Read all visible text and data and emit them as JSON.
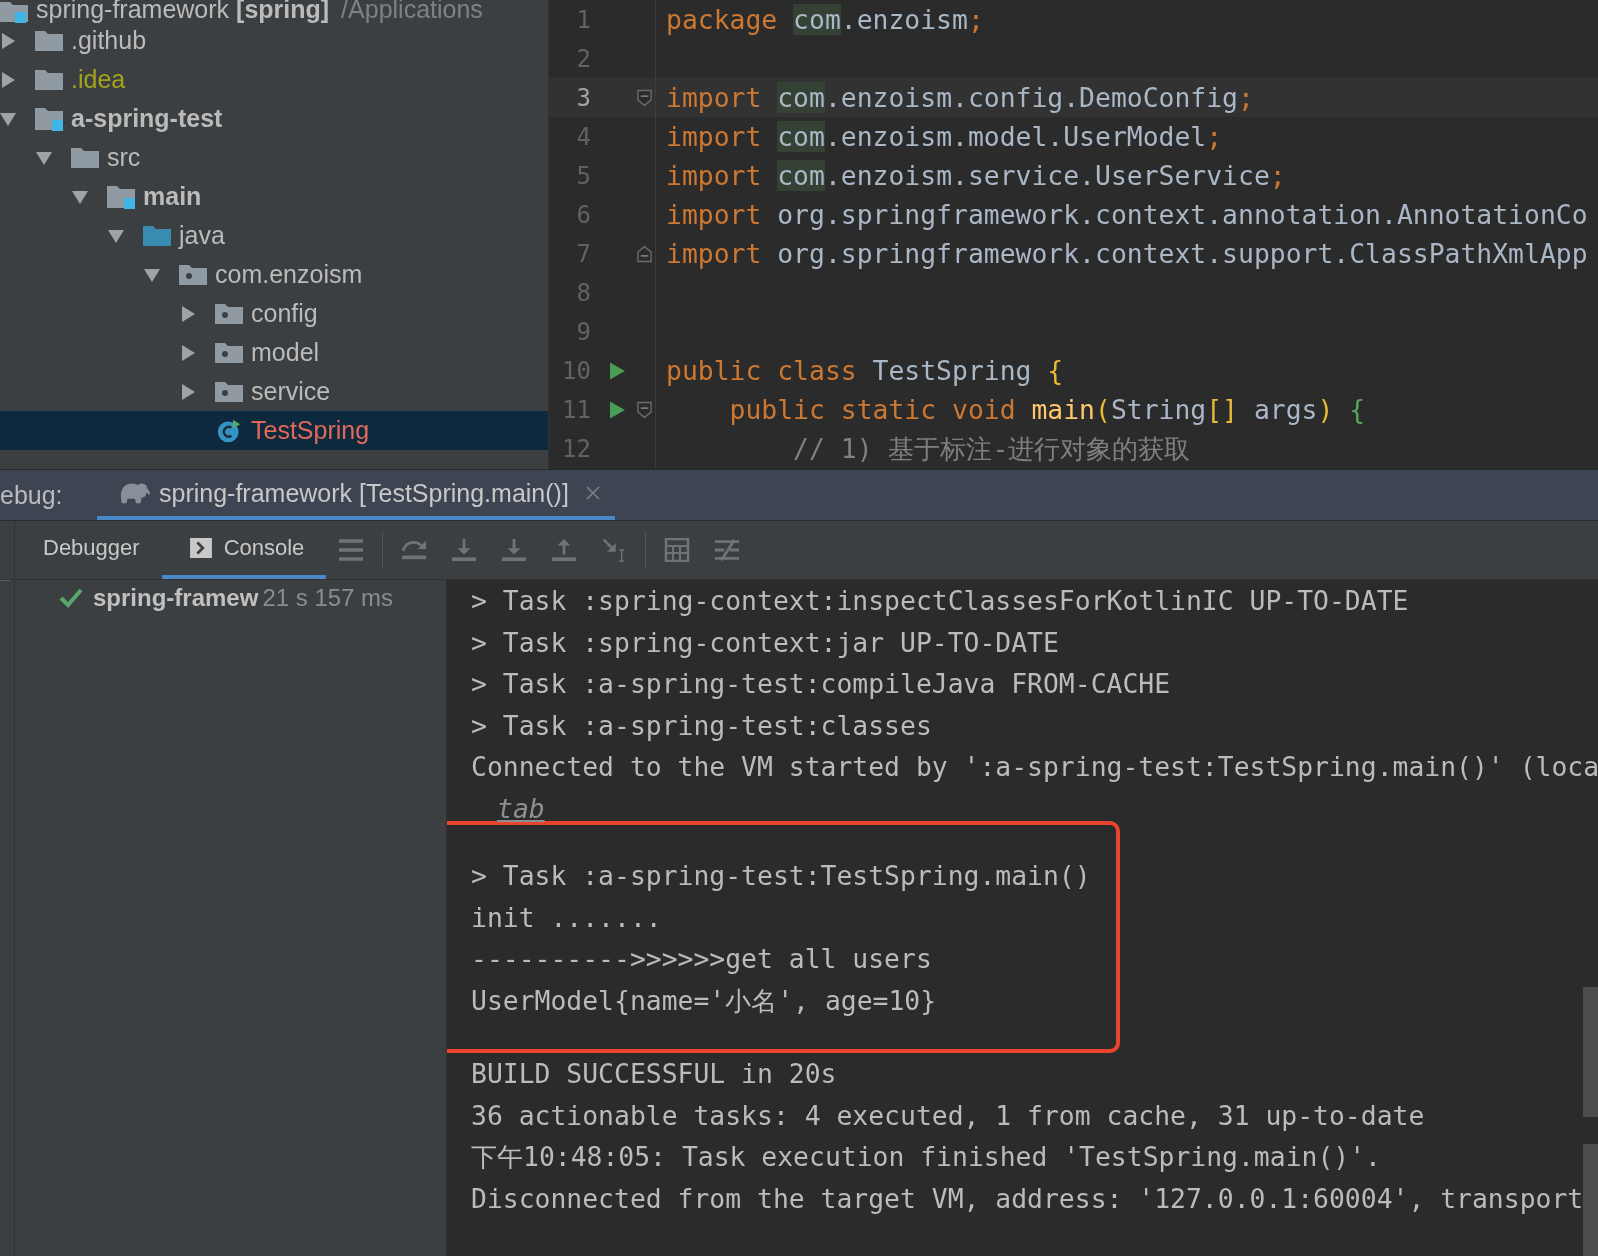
{
  "project_tree": {
    "root": {
      "label": "spring-framework **[spring]**",
      "path": "/Applications",
      "children": [
        {
          "label": ".github",
          "kind": "folder",
          "color": "#bbbbbb",
          "expanded": false,
          "selected": false
        },
        {
          "label": ".idea",
          "kind": "folder",
          "color": "#a2a21c",
          "expanded": false,
          "selected": false
        },
        {
          "label": "a-spring-test",
          "kind": "module",
          "color": "#bbbbbb",
          "expanded": true,
          "selected": false,
          "children": [
            {
              "label": "src",
              "kind": "folder",
              "color": "#bbbbbb",
              "expanded": true,
              "selected": false,
              "children": [
                {
                  "label": "main",
                  "kind": "module",
                  "color": "#bbbbbb",
                  "expanded": true,
                  "selected": false,
                  "children": [
                    {
                      "label": "java",
                      "kind": "source",
                      "color": "#bbbbbb",
                      "expanded": true,
                      "selected": false,
                      "children": [
                        {
                          "label": "com.enzoism",
                          "kind": "package",
                          "color": "#bbbbbb",
                          "expanded": true,
                          "selected": false,
                          "children": [
                            {
                              "label": "config",
                              "kind": "package",
                              "color": "#bbbbbb",
                              "expanded": false,
                              "selected": false
                            },
                            {
                              "label": "model",
                              "kind": "package",
                              "color": "#bbbbbb",
                              "expanded": false,
                              "selected": false
                            },
                            {
                              "label": "service",
                              "kind": "package",
                              "color": "#bbbbbb",
                              "expanded": false,
                              "selected": false
                            },
                            {
                              "label": "TestSpring",
                              "kind": "class",
                              "color": "#e0695a",
                              "selected": true
                            }
                          ]
                        }
                      ]
                    }
                  ]
                }
              ]
            }
          ]
        }
      ]
    }
  },
  "editor": {
    "lines": [
      {
        "number": "1",
        "current": false,
        "run": false,
        "fold_start": false,
        "fold_end": false,
        "tokens": [
          {
            "kind": "keyword",
            "text": "package "
          },
          {
            "kind": "highlight",
            "text": "com"
          },
          {
            "kind": "plain",
            "text": ".enzoism"
          },
          {
            "kind": "keyword",
            "text": ";"
          }
        ]
      },
      {
        "number": "2",
        "current": false,
        "run": false,
        "fold_start": false,
        "fold_end": false
      },
      {
        "number": "3",
        "current": true,
        "run": false,
        "fold_start": true,
        "fold_end": false,
        "tokens": [
          {
            "kind": "keyword",
            "text": "import "
          },
          {
            "kind": "highlight",
            "text": "com"
          },
          {
            "kind": "plain",
            "text": ".enzoism.config.DemoConfig"
          },
          {
            "kind": "keyword",
            "text": ";"
          }
        ]
      },
      {
        "number": "4",
        "current": false,
        "run": false,
        "fold_start": false,
        "fold_end": false,
        "tokens": [
          {
            "kind": "keyword",
            "text": "import "
          },
          {
            "kind": "highlight",
            "text": "com"
          },
          {
            "kind": "plain",
            "text": ".enzoism.model.UserModel"
          },
          {
            "kind": "keyword",
            "text": ";"
          }
        ]
      },
      {
        "number": "5",
        "current": false,
        "run": false,
        "fold_start": false,
        "fold_end": false,
        "tokens": [
          {
            "kind": "keyword",
            "text": "import "
          },
          {
            "kind": "highlight",
            "text": "com"
          },
          {
            "kind": "plain",
            "text": ".enzoism.service.UserService"
          },
          {
            "kind": "keyword",
            "text": ";"
          }
        ]
      },
      {
        "number": "6",
        "current": false,
        "run": false,
        "fold_start": false,
        "fold_end": false,
        "tokens": [
          {
            "kind": "keyword",
            "text": "import"
          },
          {
            "kind": "plain",
            "text": " org.springframework.context.annotation.AnnotationCo"
          }
        ]
      },
      {
        "number": "7",
        "current": false,
        "run": false,
        "fold_start": false,
        "fold_end": true,
        "tokens": [
          {
            "kind": "keyword",
            "text": "import"
          },
          {
            "kind": "plain",
            "text": " org.springframework.context.support.ClassPathXmlApp"
          }
        ]
      },
      {
        "number": "8",
        "current": false,
        "run": false,
        "fold_start": false,
        "fold_end": false
      },
      {
        "number": "9",
        "current": false,
        "run": false,
        "fold_start": false,
        "fold_end": false
      },
      {
        "number": "10",
        "current": false,
        "run": true,
        "fold_start": false,
        "fold_end": false,
        "tokens": [
          {
            "kind": "keyword",
            "text": "public class"
          },
          {
            "kind": "plain",
            "text": " TestSpring "
          },
          {
            "kind": "brace1",
            "text": "{"
          }
        ]
      },
      {
        "number": "11",
        "current": false,
        "run": true,
        "fold_start": true,
        "fold_end": false,
        "tokens": [
          {
            "kind": "keyword",
            "text": "    public static void "
          },
          {
            "kind": "method",
            "text": "main"
          },
          {
            "kind": "brace1",
            "text": "("
          },
          {
            "kind": "plain",
            "text": "String"
          },
          {
            "kind": "brace1",
            "text": "[]"
          },
          {
            "kind": "plain",
            "text": " args"
          },
          {
            "kind": "brace1",
            "text": ")"
          },
          {
            "kind": "brace2",
            "text": " {"
          }
        ]
      },
      {
        "number": "12",
        "current": false,
        "run": false,
        "fold_start": false,
        "fold_end": false,
        "tokens": [
          {
            "kind": "comment",
            "text": "        // 1) 基于标注-进行对象的获取"
          }
        ]
      }
    ]
  },
  "debug_bar": {
    "label": "ebug:",
    "tabs": [
      {
        "label": "spring-framework [TestSpring.main()]",
        "selected": true
      }
    ]
  },
  "tool_tabs": [
    {
      "label": "Debugger",
      "kind": "debugger",
      "selected": false
    },
    {
      "label": "Console",
      "kind": "console",
      "selected": true
    }
  ],
  "runs": [
    {
      "name": "spring-framew",
      "time": "21 s 157 ms",
      "passed": true
    }
  ],
  "console": {
    "segments": [
      {
        "boxed": false,
        "lines": [
          {
            "kind": "text",
            "text": "> Task :spring-context:inspectClassesForKotlinIC UP-TO-DATE"
          },
          {
            "kind": "text",
            "text": "> Task :spring-context:jar UP-TO-DATE"
          },
          {
            "kind": "text",
            "text": "> Task :a-spring-test:compileJava FROM-CACHE"
          },
          {
            "kind": "text",
            "text": "> Task :a-spring-test:classes"
          },
          {
            "kind": "text",
            "text": "Connected to the VM started by ':a-spring-test:TestSpring.main()' (loca"
          },
          {
            "kind": "link",
            "text": "tab"
          }
        ]
      },
      {
        "boxed": true,
        "lines": [
          {
            "kind": "text",
            "text": "> Task :a-spring-test:TestSpring.main()"
          },
          {
            "kind": "text",
            "text": "init ......."
          },
          {
            "kind": "text",
            "text": "---------->>>>>>get all users"
          },
          {
            "kind": "text",
            "text": "UserModel{name='小名', age=10}"
          }
        ]
      },
      {
        "boxed": false,
        "lines": [
          {
            "kind": "text",
            "text": "BUILD SUCCESSFUL in 20s"
          },
          {
            "kind": "text",
            "text": "36 actionable tasks: 4 executed, 1 from cache, 31 up-to-date"
          },
          {
            "kind": "text",
            "text": "下午10:48:05: Task execution finished 'TestSpring.main()'."
          },
          {
            "kind": "text",
            "text": "Disconnected from the target VM, address: '127.0.0.1:60004', transport"
          }
        ]
      }
    ]
  }
}
